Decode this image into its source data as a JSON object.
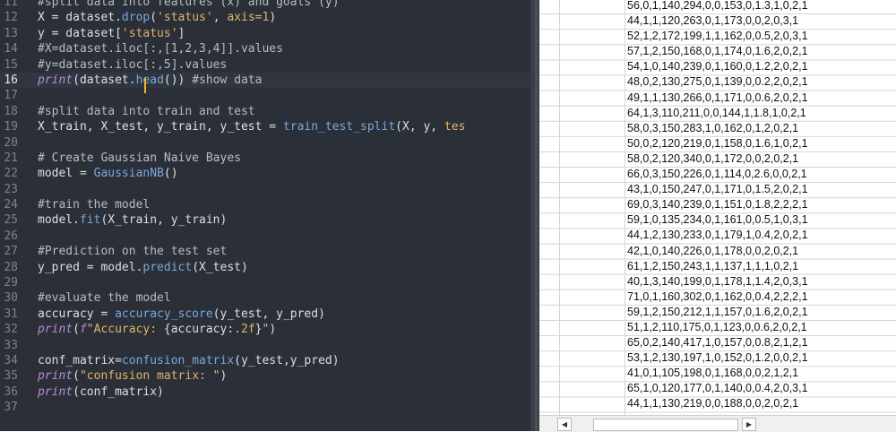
{
  "editor": {
    "current_line": 16,
    "lines": [
      {
        "n": "11",
        "segments": [
          {
            "t": "#split data into features (x) and goals (y)",
            "c": "cmt"
          }
        ]
      },
      {
        "n": "12",
        "segments": [
          {
            "t": "X = dataset.",
            "c": "op"
          },
          {
            "t": "drop",
            "c": "fn"
          },
          {
            "t": "(",
            "c": "op"
          },
          {
            "t": "'status'",
            "c": "str"
          },
          {
            "t": ", ",
            "c": "op"
          },
          {
            "t": "axis=1",
            "c": "str"
          },
          {
            "t": ")",
            "c": "op"
          }
        ]
      },
      {
        "n": "13",
        "segments": [
          {
            "t": "y = dataset[",
            "c": "op"
          },
          {
            "t": "'status'",
            "c": "str"
          },
          {
            "t": "]",
            "c": "op"
          }
        ]
      },
      {
        "n": "14",
        "segments": [
          {
            "t": "#X=dataset.iloc[:,[1,2,3,4]].values",
            "c": "cmt"
          }
        ]
      },
      {
        "n": "15",
        "segments": [
          {
            "t": "#y=dataset.iloc[:,5].values",
            "c": "cmt"
          }
        ]
      },
      {
        "n": "16",
        "segments": [
          {
            "t": "print",
            "c": "kw"
          },
          {
            "t": "(dataset.",
            "c": "op"
          },
          {
            "t": "head",
            "c": "fn"
          },
          {
            "t": "()) ",
            "c": "op"
          },
          {
            "t": "#show data",
            "c": "cmt"
          }
        ]
      },
      {
        "n": "17",
        "segments": []
      },
      {
        "n": "18",
        "segments": [
          {
            "t": "#split data into train and test",
            "c": "cmt"
          }
        ]
      },
      {
        "n": "19",
        "segments": [
          {
            "t": "X_train, X_test, y_train, y_test = ",
            "c": "op"
          },
          {
            "t": "train_test_split",
            "c": "fn"
          },
          {
            "t": "(X, y, ",
            "c": "op"
          },
          {
            "t": "tes",
            "c": "str"
          }
        ]
      },
      {
        "n": "20",
        "segments": []
      },
      {
        "n": "21",
        "segments": [
          {
            "t": "# Create Gaussian Naive Bayes",
            "c": "cmt"
          }
        ]
      },
      {
        "n": "22",
        "segments": [
          {
            "t": "model = ",
            "c": "op"
          },
          {
            "t": "GaussianNB",
            "c": "fn"
          },
          {
            "t": "()",
            "c": "op"
          }
        ]
      },
      {
        "n": "23",
        "segments": []
      },
      {
        "n": "24",
        "segments": [
          {
            "t": "#train the model",
            "c": "cmt"
          }
        ]
      },
      {
        "n": "25",
        "segments": [
          {
            "t": "model.",
            "c": "op"
          },
          {
            "t": "fit",
            "c": "fn"
          },
          {
            "t": "(X_train, y_train)",
            "c": "op"
          }
        ]
      },
      {
        "n": "26",
        "segments": []
      },
      {
        "n": "27",
        "segments": [
          {
            "t": "#Prediction on the test set",
            "c": "cmt"
          }
        ]
      },
      {
        "n": "28",
        "segments": [
          {
            "t": "y_pred = model.",
            "c": "op"
          },
          {
            "t": "predict",
            "c": "fn"
          },
          {
            "t": "(X_test)",
            "c": "op"
          }
        ]
      },
      {
        "n": "29",
        "segments": []
      },
      {
        "n": "30",
        "segments": [
          {
            "t": "#evaluate the model",
            "c": "cmt"
          }
        ]
      },
      {
        "n": "31",
        "segments": [
          {
            "t": "accuracy = ",
            "c": "op"
          },
          {
            "t": "accuracy_score",
            "c": "fn"
          },
          {
            "t": "(y_test, y_pred)",
            "c": "op"
          }
        ]
      },
      {
        "n": "32",
        "segments": [
          {
            "t": "print",
            "c": "kw"
          },
          {
            "t": "(",
            "c": "op"
          },
          {
            "t": "f",
            "c": "kw"
          },
          {
            "t": "\"Accuracy: ",
            "c": "str"
          },
          {
            "t": "{accuracy:",
            "c": "op"
          },
          {
            "t": ".2f",
            "c": "str"
          },
          {
            "t": "}",
            "c": "op"
          },
          {
            "t": "\"",
            "c": "str"
          },
          {
            "t": ")",
            "c": "op"
          }
        ]
      },
      {
        "n": "33",
        "segments": []
      },
      {
        "n": "34",
        "segments": [
          {
            "t": "conf_matrix=",
            "c": "op"
          },
          {
            "t": "confusion_matrix",
            "c": "fn"
          },
          {
            "t": "(y_test,y_pred)",
            "c": "op"
          }
        ]
      },
      {
        "n": "35",
        "segments": [
          {
            "t": "print",
            "c": "kw"
          },
          {
            "t": "(",
            "c": "op"
          },
          {
            "t": "\"confusion matrix: \"",
            "c": "str"
          },
          {
            "t": ")",
            "c": "op"
          }
        ]
      },
      {
        "n": "36",
        "segments": [
          {
            "t": "print",
            "c": "kw"
          },
          {
            "t": "(conf_matrix)",
            "c": "op"
          }
        ]
      },
      {
        "n": "37",
        "segments": []
      }
    ]
  },
  "sheet": {
    "rows": [
      "56,0,1,140,294,0,0,153,0,1.3,1,0,2,1",
      "44,1,1,120,263,0,1,173,0,0,2,0,3,1",
      "52,1,2,172,199,1,1,162,0,0.5,2,0,3,1",
      "57,1,2,150,168,0,1,174,0,1.6,2,0,2,1",
      "54,1,0,140,239,0,1,160,0,1.2,2,0,2,1",
      "48,0,2,130,275,0,1,139,0,0.2,2,0,2,1",
      "49,1,1,130,266,0,1,171,0,0.6,2,0,2,1",
      "64,1,3,110,211,0,0,144,1,1.8,1,0,2,1",
      "58,0,3,150,283,1,0,162,0,1,2,0,2,1",
      "50,0,2,120,219,0,1,158,0,1.6,1,0,2,1",
      "58,0,2,120,340,0,1,172,0,0,2,0,2,1",
      "66,0,3,150,226,0,1,114,0,2.6,0,0,2,1",
      "43,1,0,150,247,0,1,171,0,1.5,2,0,2,1",
      "69,0,3,140,239,0,1,151,0,1.8,2,2,2,1",
      "59,1,0,135,234,0,1,161,0,0.5,1,0,3,1",
      "44,1,2,130,233,0,1,179,1,0.4,2,0,2,1",
      "42,1,0,140,226,0,1,178,0,0,2,0,2,1",
      "61,1,2,150,243,1,1,137,1,1,1,0,2,1",
      "40,1,3,140,199,0,1,178,1,1.4,2,0,3,1",
      "71,0,1,160,302,0,1,162,0,0.4,2,2,2,1",
      "59,1,2,150,212,1,1,157,0,1.6,2,0,2,1",
      "51,1,2,110,175,0,1,123,0,0.6,2,0,2,1",
      "65,0,2,140,417,1,0,157,0,0.8,2,1,2,1",
      "53,1,2,130,197,1,0,152,0,1.2,0,0,2,1",
      "41,0,1,105,198,0,1,168,0,0,2,1,2,1",
      "65,1,0,120,177,0,1,140,0,0.4,2,0,3,1",
      "44,1,1,130,219,0,0,188,0,0,2,0,2,1"
    ]
  },
  "scrollbar": {
    "left_arrow": "◀",
    "right_arrow": "▶"
  }
}
